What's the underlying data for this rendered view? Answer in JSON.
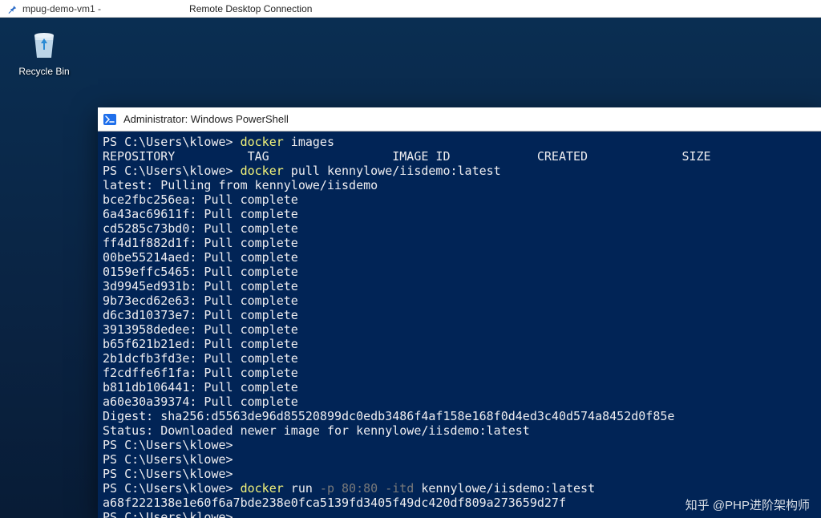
{
  "rdp": {
    "pin_icon": "pushpin",
    "host": "mpug-demo-vm1 -",
    "app": "Remote Desktop Connection"
  },
  "desktop": {
    "recycle_label": "Recycle Bin"
  },
  "powershell": {
    "title": "Administrator: Windows PowerShell",
    "prompt": "PS C:\\Users\\klowe>",
    "lines": [
      {
        "prompt": "PS C:\\Users\\klowe> ",
        "cmd": "docker",
        "args": " images"
      },
      {
        "plain": "REPOSITORY          TAG                 IMAGE ID            CREATED             SIZE"
      },
      {
        "prompt": "PS C:\\Users\\klowe> ",
        "cmd": "docker",
        "args": " pull kennylowe/iisdemo:latest"
      },
      {
        "plain": "latest: Pulling from kennylowe/iisdemo"
      },
      {
        "plain": "bce2fbc256ea: Pull complete"
      },
      {
        "plain": "6a43ac69611f: Pull complete"
      },
      {
        "plain": "cd5285c73bd0: Pull complete"
      },
      {
        "plain": "ff4d1f882d1f: Pull complete"
      },
      {
        "plain": "00be55214aed: Pull complete"
      },
      {
        "plain": "0159effc5465: Pull complete"
      },
      {
        "plain": "3d9945ed931b: Pull complete"
      },
      {
        "plain": "9b73ecd62e63: Pull complete"
      },
      {
        "plain": "d6c3d10373e7: Pull complete"
      },
      {
        "plain": "3913958dedee: Pull complete"
      },
      {
        "plain": "b65f621b21ed: Pull complete"
      },
      {
        "plain": "2b1dcfb3fd3e: Pull complete"
      },
      {
        "plain": "f2cdffe6f1fa: Pull complete"
      },
      {
        "plain": "b811db106441: Pull complete"
      },
      {
        "plain": "a60e30a39374: Pull complete"
      },
      {
        "plain": "Digest: sha256:d5563de96d85520899dc0edb3486f4af158e168f0d4ed3c40d574a8452d0f85e"
      },
      {
        "plain": "Status: Downloaded newer image for kennylowe/iisdemo:latest"
      },
      {
        "prompt": "PS C:\\Users\\klowe>",
        "cmd": "",
        "args": ""
      },
      {
        "prompt": "PS C:\\Users\\klowe>",
        "cmd": "",
        "args": ""
      },
      {
        "prompt": "PS C:\\Users\\klowe>",
        "cmd": "",
        "args": ""
      },
      {
        "prompt": "PS C:\\Users\\klowe> ",
        "cmd": "docker",
        "args_run": " run",
        "flags": " -p 80:80 -itd",
        "rest": " kennylowe/iisdemo:latest"
      },
      {
        "plain": "a68f222138e1e60f6a7bde238e0fca5139fd3405f49dc420df809a273659d27f"
      },
      {
        "prompt": "PS C:\\Users\\klowe> ",
        "cursor": true
      }
    ]
  },
  "watermark": "知乎 @PHP进阶架构师"
}
